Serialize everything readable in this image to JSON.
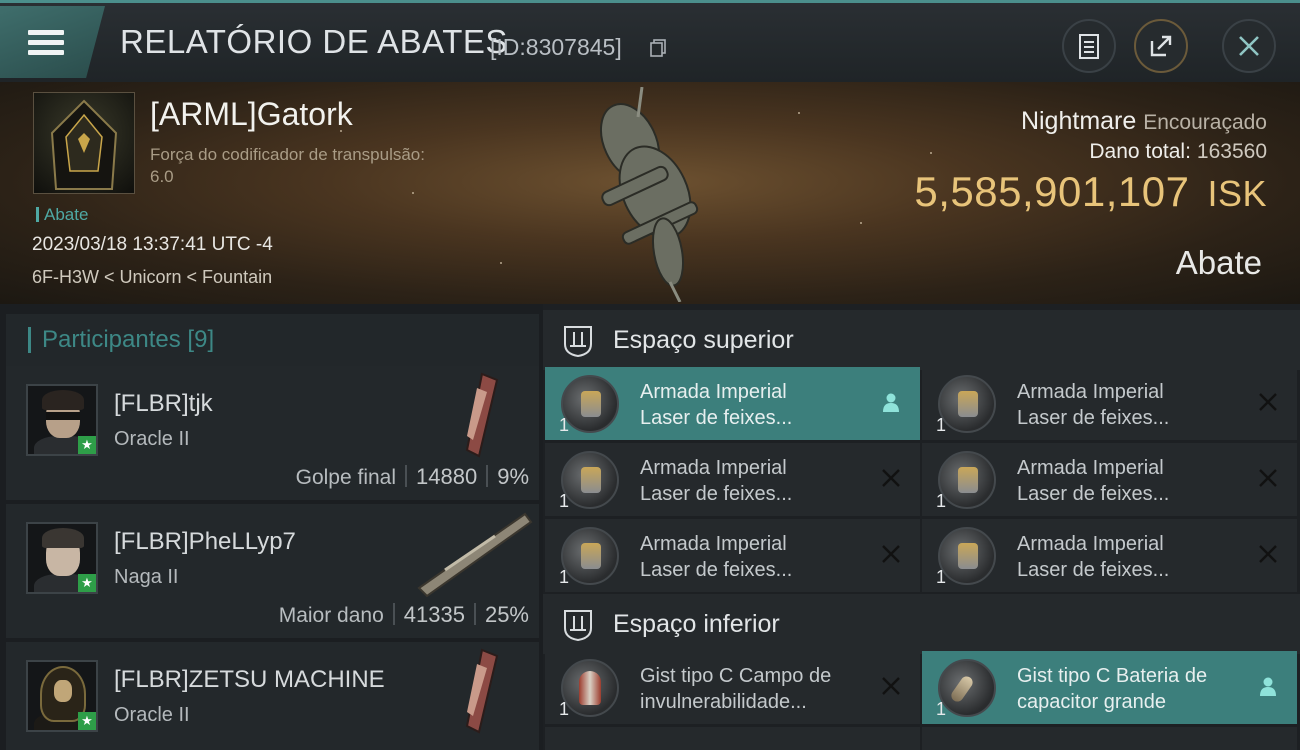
{
  "header": {
    "title": "RELATÓRIO DE ABATES",
    "report_id": "[ID:8307845]"
  },
  "victim": {
    "name": "[ARML]Gatork",
    "stat_label": "Força do codificador de transpulsão:",
    "stat_value": "6.0",
    "tag": "Abate",
    "datetime": "2023/03/18 13:37:41 UTC -4",
    "location": "6F-H3W < Unicorn < Fountain",
    "ship_name": "Nightmare",
    "ship_class": "Encouraçado",
    "damage_label": "Dano total:",
    "damage_value": "163560",
    "isk_value": "5,585,901,107",
    "isk_unit": "ISK",
    "kill_type": "Abate"
  },
  "participants": {
    "label": "Participantes",
    "count": "[9]",
    "items": [
      {
        "name": "[FLBR]tjk",
        "ship": "Oracle II",
        "role": "Golpe final",
        "damage": "14880",
        "percent": "9%"
      },
      {
        "name": "[FLBR]PheLLyp7",
        "ship": "Naga II",
        "role": "Maior dano",
        "damage": "41335",
        "percent": "25%"
      },
      {
        "name": "[FLBR]ZETSU MACHINE",
        "ship": "Oracle II"
      }
    ]
  },
  "fitting": {
    "high_label": "Espaço superior",
    "low_label": "Espaço inferior",
    "high": [
      {
        "line1": "Armada Imperial",
        "line2": "Laser de feixes...",
        "qty": "1",
        "state": "user-icon"
      },
      {
        "line1": "Armada Imperial",
        "line2": "Laser de feixes...",
        "qty": "1",
        "state": "close-icon"
      },
      {
        "line1": "Armada Imperial",
        "line2": "Laser de feixes...",
        "qty": "1",
        "state": "close-icon"
      },
      {
        "line1": "Armada Imperial",
        "line2": "Laser de feixes...",
        "qty": "1",
        "state": "close-icon"
      },
      {
        "line1": "Armada Imperial",
        "line2": "Laser de feixes...",
        "qty": "1",
        "state": "close-icon"
      },
      {
        "line1": "Armada Imperial",
        "line2": "Laser de feixes...",
        "qty": "1",
        "state": "close-icon"
      }
    ],
    "low": [
      {
        "line1": "Gist tipo C Campo de",
        "line2": "invulnerabilidade...",
        "qty": "1",
        "state": "close-icon"
      },
      {
        "line1": "Gist tipo C Bateria de",
        "line2": "capacitor grande",
        "qty": "1",
        "state": "user-icon"
      }
    ]
  },
  "colors": {
    "accent_teal": "#3c7f7c",
    "isk_gold": "#e8c47a",
    "check_green": "#2e9e48"
  }
}
